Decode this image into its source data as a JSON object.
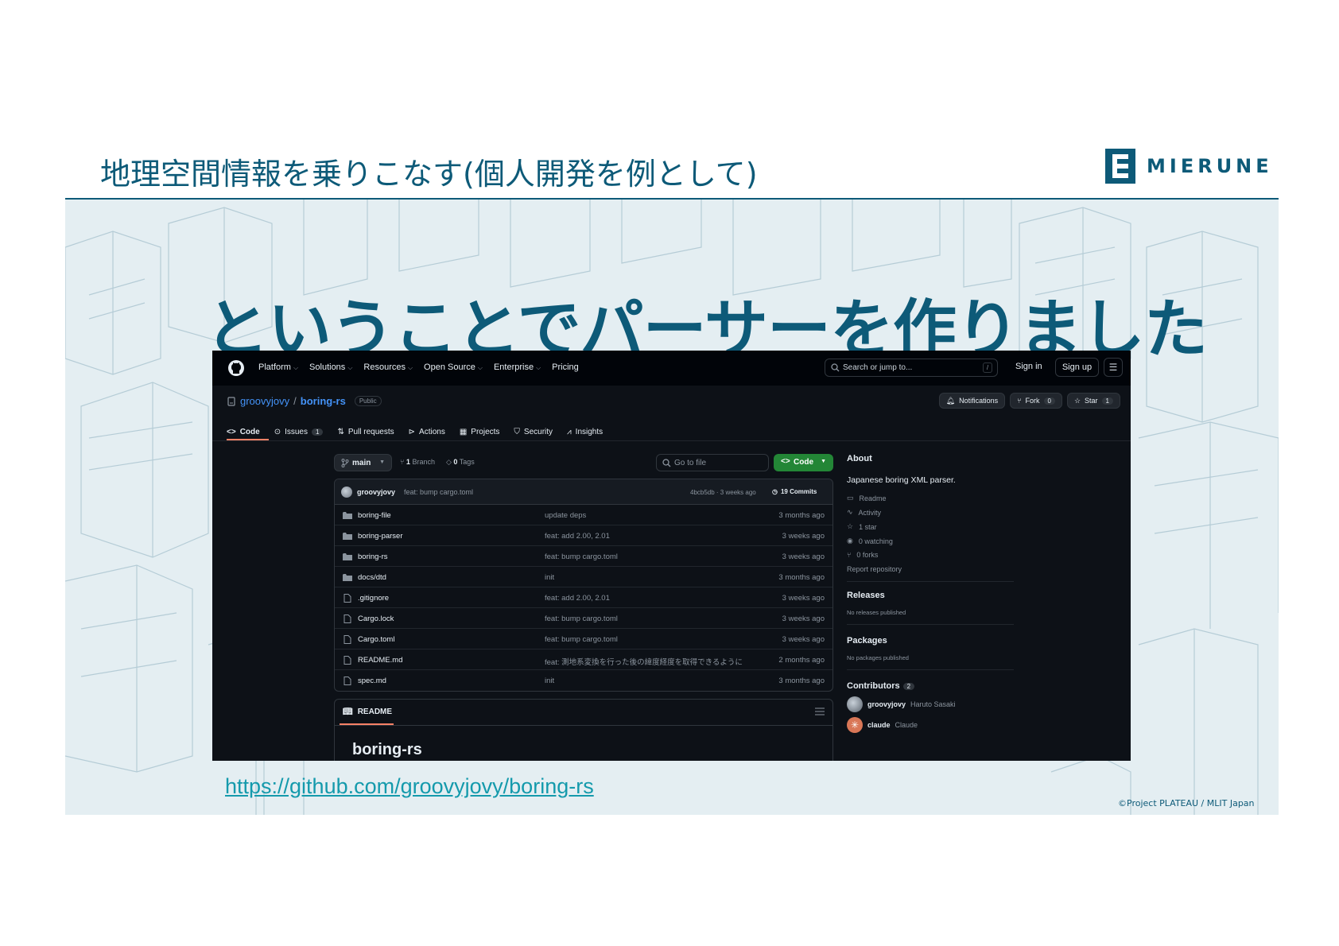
{
  "slide": {
    "title": "地理空間情報を乗りこなす(個人開発を例として)",
    "brand": "MIERUNE",
    "heading": "ということでパーサーを作りました",
    "url": "https://github.com/groovyjovy/boring-rs",
    "copyright": "©Project PLATEAU / MLIT Japan",
    "accent_color": "#0d5a78",
    "link_color": "#149aac"
  },
  "github": {
    "nav": [
      "Platform",
      "Solutions",
      "Resources",
      "Open Source",
      "Enterprise",
      "Pricing"
    ],
    "search_placeholder": "Search or jump to...",
    "search_shortcut": "/",
    "sign_in": "Sign in",
    "sign_up": "Sign up",
    "repo": {
      "owner": "groovyjovy",
      "separator": "/",
      "name": "boring-rs",
      "visibility": "Public"
    },
    "actions": {
      "notifications": "Notifications",
      "fork": "Fork",
      "fork_count": "0",
      "star": "Star",
      "star_count": "1"
    },
    "tabs": {
      "code": "Code",
      "issues": "Issues",
      "issues_count": "1",
      "pulls": "Pull requests",
      "actions": "Actions",
      "projects": "Projects",
      "security": "Security",
      "insights": "Insights"
    },
    "branch": "main",
    "branch_count": "1",
    "branch_label": "Branch",
    "tag_count": "0",
    "tag_label": "Tags",
    "goto_file": "Go to file",
    "code_button": "Code",
    "commit": {
      "author": "groovyjovy",
      "message": "feat: bump cargo.toml",
      "hash": "4bcb5db · 3 weeks ago",
      "commits": "19 Commits"
    },
    "files": [
      {
        "type": "folder",
        "name": "boring-file",
        "message": "update deps",
        "time": "3 months ago"
      },
      {
        "type": "folder",
        "name": "boring-parser",
        "message": "feat: add 2.00, 2.01",
        "time": "3 weeks ago"
      },
      {
        "type": "folder",
        "name": "boring-rs",
        "message": "feat: bump cargo.toml",
        "time": "3 weeks ago"
      },
      {
        "type": "folder",
        "name": "docs/dtd",
        "message": "init",
        "time": "3 months ago"
      },
      {
        "type": "file",
        "name": ".gitignore",
        "message": "feat: add 2.00, 2.01",
        "time": "3 weeks ago"
      },
      {
        "type": "file",
        "name": "Cargo.lock",
        "message": "feat: bump cargo.toml",
        "time": "3 weeks ago"
      },
      {
        "type": "file",
        "name": "Cargo.toml",
        "message": "feat: bump cargo.toml",
        "time": "3 weeks ago"
      },
      {
        "type": "file",
        "name": "README.md",
        "message": "feat: 測地系変換を行った後の緯度経度を取得できるように",
        "time": "2 months ago"
      },
      {
        "type": "file",
        "name": "spec.md",
        "message": "init",
        "time": "3 months ago"
      }
    ],
    "readme": {
      "tab": "README",
      "title": "boring-rs"
    },
    "about": {
      "heading": "About",
      "description": "Japanese boring XML parser.",
      "readme": "Readme",
      "activity": "Activity",
      "stars": "1 star",
      "watching": "0 watching",
      "forks": "0 forks",
      "report": "Report repository"
    },
    "releases": {
      "heading": "Releases",
      "text": "No releases published"
    },
    "packages": {
      "heading": "Packages",
      "text": "No packages published"
    },
    "contributors": {
      "heading": "Contributors",
      "count": "2",
      "list": [
        {
          "login": "groovyjovy",
          "name": "Haruto Sasaki"
        },
        {
          "login": "claude",
          "name": "Claude"
        }
      ]
    }
  }
}
